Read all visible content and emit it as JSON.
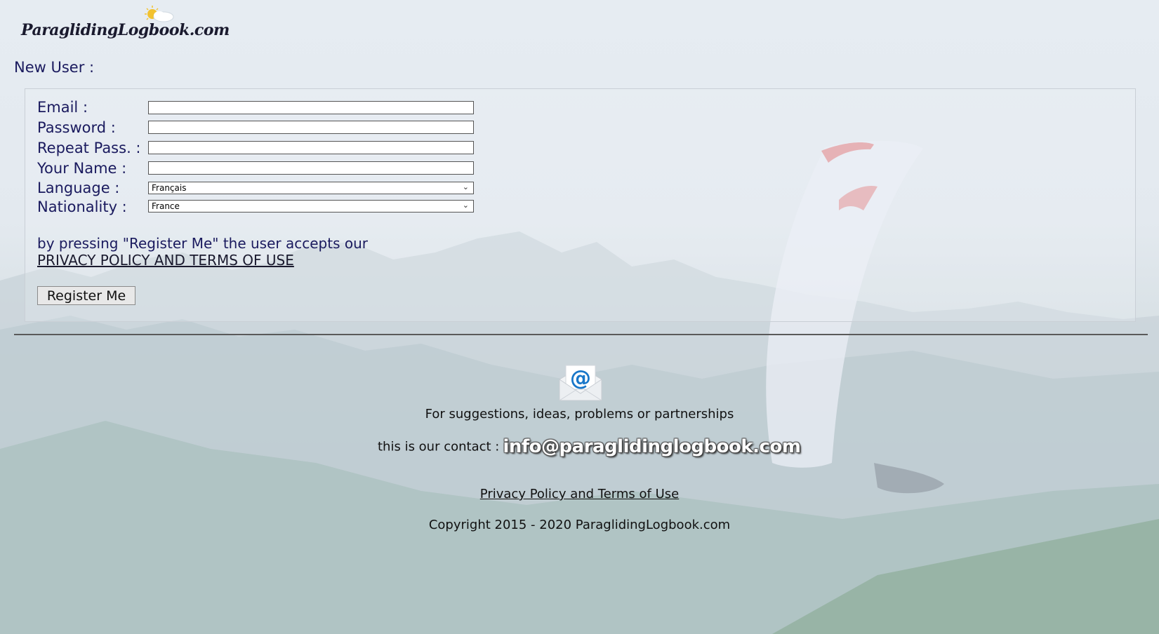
{
  "header": {
    "logo_text": "ParaglidingLogbook.com"
  },
  "page": {
    "title": "New User :"
  },
  "form": {
    "email_label": "Email :",
    "password_label": "Password :",
    "repeat_label": "Repeat Pass. :",
    "name_label": "Your Name :",
    "language_label": "Language :",
    "language_value": "Français",
    "nationality_label": "Nationality :",
    "nationality_value": "France",
    "email_value": "",
    "password_value": "",
    "repeat_value": "",
    "name_value": "",
    "terms_text": "by pressing \"Register Me\" the user accepts our",
    "terms_link": "PRIVACY POLICY AND TERMS OF USE",
    "register_button": "Register Me"
  },
  "footer": {
    "suggestions": "For suggestions, ideas, problems or partnerships",
    "contact_label": "this is our contact :",
    "contact_email": "info@paraglidinglogbook.com",
    "privacy_link": "Privacy Policy and Terms of Use",
    "copyright": "Copyright 2015 - 2020 ParaglidingLogbook.com"
  },
  "colors": {
    "label": "#1a1a5e",
    "divider": "#5a5a5a",
    "background_sky": "#e6ecf2",
    "mountains": "#b9c8cf"
  },
  "icons": {
    "logo_sun": "sun-cloud-icon",
    "mail": "email-envelope-icon",
    "select_chevron": "chevron-down-icon"
  }
}
